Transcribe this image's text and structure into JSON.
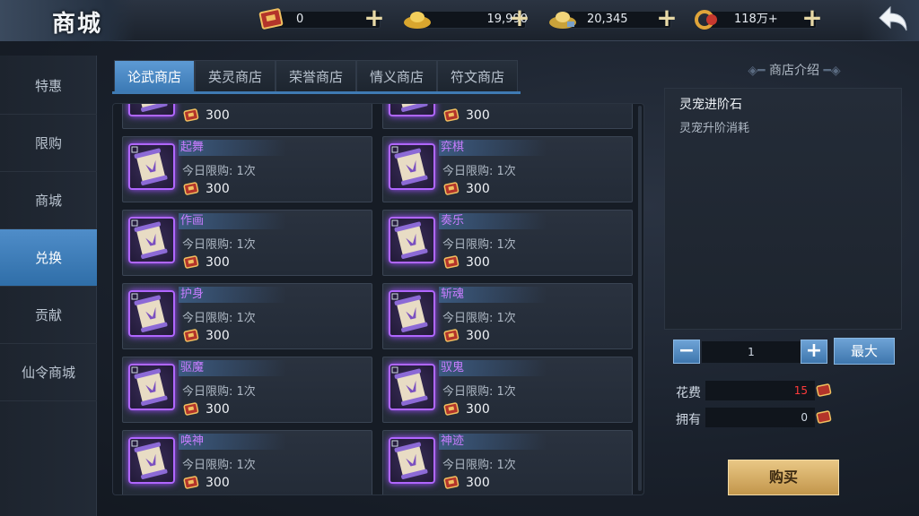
{
  "page": {
    "title": "商城"
  },
  "resources": [
    {
      "name": "scroll-ticket",
      "value": "0"
    },
    {
      "name": "gold-ingot",
      "value": "19,990"
    },
    {
      "name": "silver-ingot",
      "value": "20,345"
    },
    {
      "name": "coin-string",
      "value": "118万+"
    }
  ],
  "nav": {
    "items": [
      {
        "label": "特惠"
      },
      {
        "label": "限购"
      },
      {
        "label": "商城"
      },
      {
        "label": "兑换"
      },
      {
        "label": "贡献"
      },
      {
        "label": "仙令商城"
      }
    ],
    "active_index": 3
  },
  "tabs": {
    "items": [
      {
        "label": "论武商店"
      },
      {
        "label": "英灵商店"
      },
      {
        "label": "荣誉商店"
      },
      {
        "label": "情义商店"
      },
      {
        "label": "符文商店"
      }
    ],
    "active_index": 0
  },
  "items": [
    {
      "name": "",
      "limit": "",
      "price": "300"
    },
    {
      "name": "",
      "limit": "",
      "price": "300"
    },
    {
      "name": "起舞",
      "limit": "今日限购: 1次",
      "price": "300"
    },
    {
      "name": "弈棋",
      "limit": "今日限购: 1次",
      "price": "300"
    },
    {
      "name": "作画",
      "limit": "今日限购: 1次",
      "price": "300"
    },
    {
      "name": "奏乐",
      "limit": "今日限购: 1次",
      "price": "300"
    },
    {
      "name": "护身",
      "limit": "今日限购: 1次",
      "price": "300"
    },
    {
      "name": "斩魂",
      "limit": "今日限购: 1次",
      "price": "300"
    },
    {
      "name": "驱魔",
      "limit": "今日限购: 1次",
      "price": "300"
    },
    {
      "name": "驭鬼",
      "limit": "今日限购: 1次",
      "price": "300"
    },
    {
      "name": "唤神",
      "limit": "今日限购: 1次",
      "price": "300"
    },
    {
      "name": "神迹",
      "limit": "今日限购: 1次",
      "price": "300"
    }
  ],
  "panel": {
    "heading": "商店介绍",
    "item_title": "灵宠进阶石",
    "item_desc": "灵宠升阶消耗",
    "quantity": "1",
    "minus": "−",
    "plus": "+",
    "max_label": "最大",
    "cost_label": "花费",
    "cost_value": "15",
    "own_label": "拥有",
    "own_value": "0",
    "buy_label": "购买"
  },
  "colors": {
    "accent_blue": "#4f8dc9",
    "item_name": "#c77dff",
    "cost_red": "#ff3b3b",
    "buy_gold": "#e9c785"
  }
}
